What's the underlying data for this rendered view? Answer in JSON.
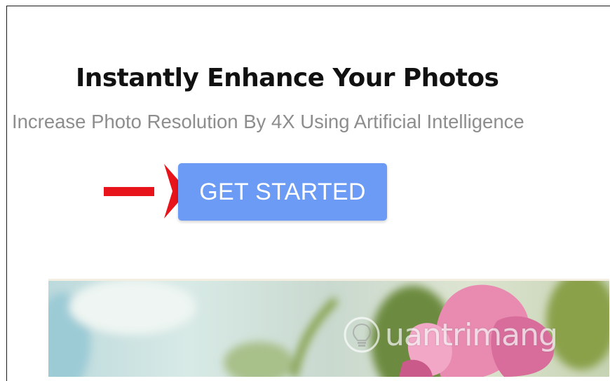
{
  "hero": {
    "title": "Instantly Enhance Your Photos",
    "subtitle": "Increase Photo Resolution By 4X Using Artificial Intelligence",
    "cta_label": "GET STARTED"
  },
  "annotation": {
    "arrow_color": "#e8141c",
    "icon": "arrow-right-icon"
  },
  "watermark": {
    "text": "uantrimang",
    "icon": "lightbulb-logo-icon"
  },
  "colors": {
    "button": "#6b9bf5",
    "subtitle": "#8d8d8d"
  }
}
